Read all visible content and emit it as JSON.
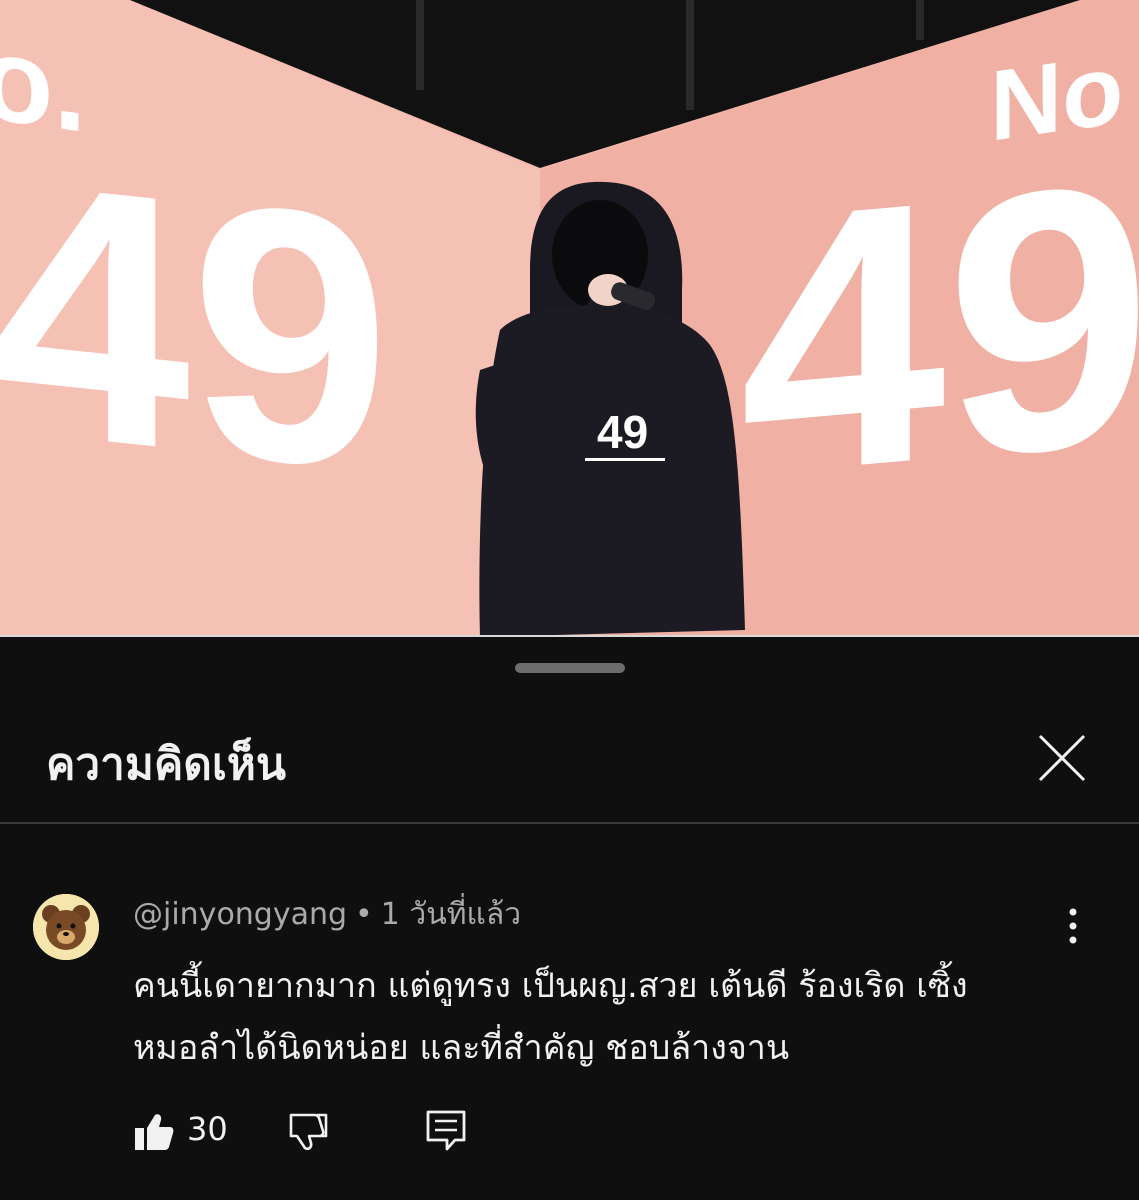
{
  "video": {
    "stage_text_left": "49",
    "stage_text_left_prefix": "o.",
    "stage_text_right": "49",
    "stage_text_right_prefix": "No",
    "hoodie_text": "49",
    "background_color": "#f4b8ac"
  },
  "sheet": {
    "title": "ความคิดเห็น",
    "close_icon": "close-icon",
    "handle_icon": "drag-handle"
  },
  "comment": {
    "author": "@jinyongyang",
    "separator": "•",
    "time": "1 วันที่แล้ว",
    "lines": [
      "คนนี้เดายากมาก แต่ดูทรง เป็นผญ.สวย เต้นดี ร้องเริด เซิ้ง",
      "หมอลำได้นิดหน่อย และที่สำคัญ ชอบล้างจาน"
    ],
    "like_count": "30",
    "avatar_icon": "bear-avatar"
  },
  "colors": {
    "background": "#0f0f0f",
    "text_primary": "#f1f1f1",
    "text_secondary": "#aaaaaa",
    "divider": "#3a3a3a"
  }
}
